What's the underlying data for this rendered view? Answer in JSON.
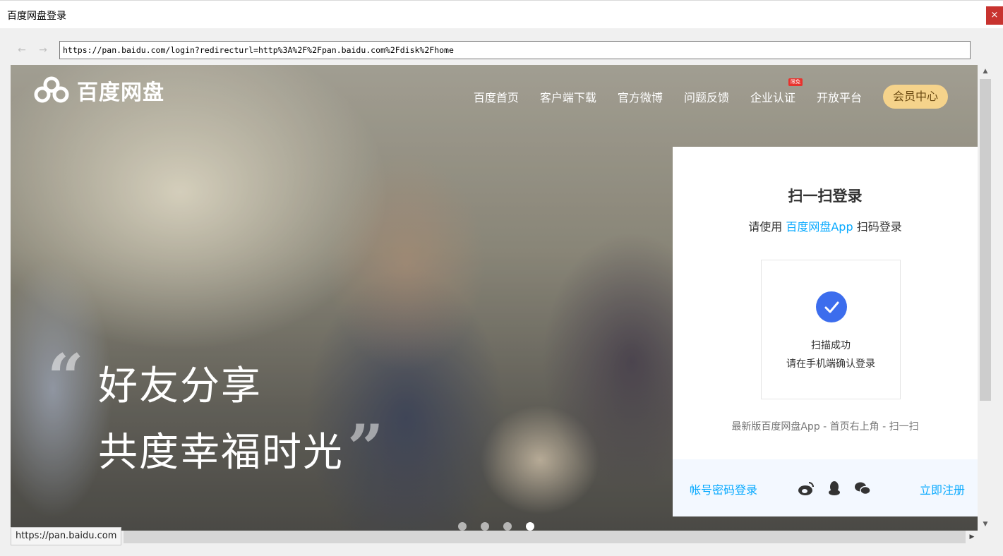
{
  "window": {
    "title": "百度网盘登录",
    "close_label": "×"
  },
  "browser": {
    "back_icon": "←",
    "forward_icon": "→",
    "url": "https://pan.baidu.com/login?redirecturl=http%3A%2F%2Fpan.baidu.com%2Fdisk%2Fhome",
    "status_url": "https://pan.baidu.com"
  },
  "header": {
    "logo_text": "百度网盘",
    "nav": [
      {
        "label": "百度首页"
      },
      {
        "label": "客户端下载"
      },
      {
        "label": "官方微博"
      },
      {
        "label": "问题反馈"
      },
      {
        "label": "企业认证",
        "badge": "限免"
      },
      {
        "label": "开放平台"
      }
    ],
    "vip_label": "会员中心"
  },
  "hero": {
    "line1": "好友分享",
    "line2": "共度幸福时光",
    "quote_open": "“",
    "quote_close": "”",
    "slides": 4,
    "active_slide": 4
  },
  "login": {
    "title": "扫一扫登录",
    "sub_prefix": "请使用",
    "sub_app": "百度网盘App",
    "sub_suffix": "扫码登录",
    "scan_ok": "扫描成功",
    "scan_hint": "请在手机端确认登录",
    "tip": "最新版百度网盘App - 首页右上角 - 扫一扫",
    "password_login": "帐号密码登录",
    "register": "立即注册",
    "social_icons": [
      "weibo-icon",
      "qq-icon",
      "wechat-icon"
    ]
  },
  "colors": {
    "accent": "#09aaff",
    "check": "#3c6ded",
    "vip_bg": "#f5d38b",
    "badge": "#e8332e"
  }
}
